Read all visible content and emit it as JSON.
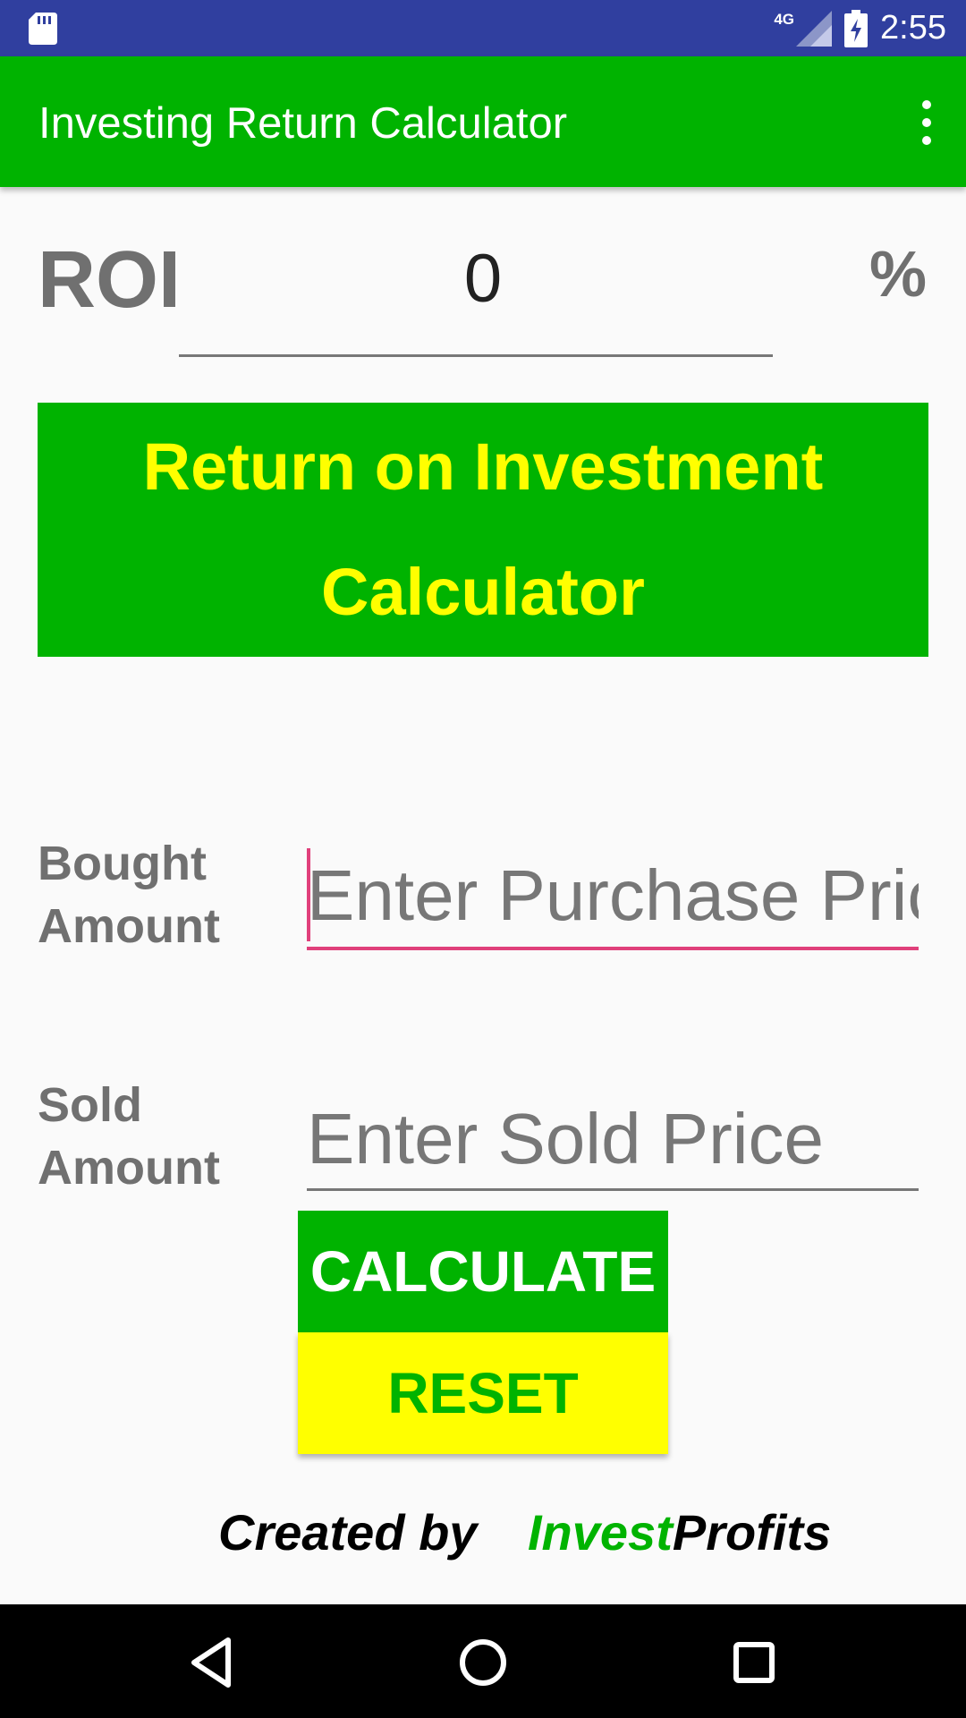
{
  "status_bar": {
    "network": "4G",
    "time": "2:55"
  },
  "app_bar": {
    "title": "Investing Return Calculator"
  },
  "result": {
    "label": "ROI",
    "value": "0",
    "unit": "%"
  },
  "banner": {
    "line1": "Return on Investment",
    "line2": "Calculator"
  },
  "form": {
    "bought_label_line1": "Bought",
    "bought_label_line2": "Amount",
    "bought_placeholder": "Enter Purchase Price",
    "bought_value": "",
    "sold_label_line1": "Sold",
    "sold_label_line2": "Amount",
    "sold_placeholder": "Enter Sold Price",
    "sold_value": ""
  },
  "buttons": {
    "calculate": "CALCULATE",
    "reset": "RESET"
  },
  "footer": {
    "created_by": "Created by",
    "brand_part1": "Invest",
    "brand_part2": "Profits"
  },
  "colors": {
    "primary_green": "#00b300",
    "accent_yellow": "#ffff00",
    "status_bar": "#303f9f",
    "focus_pink": "#e0407b"
  }
}
